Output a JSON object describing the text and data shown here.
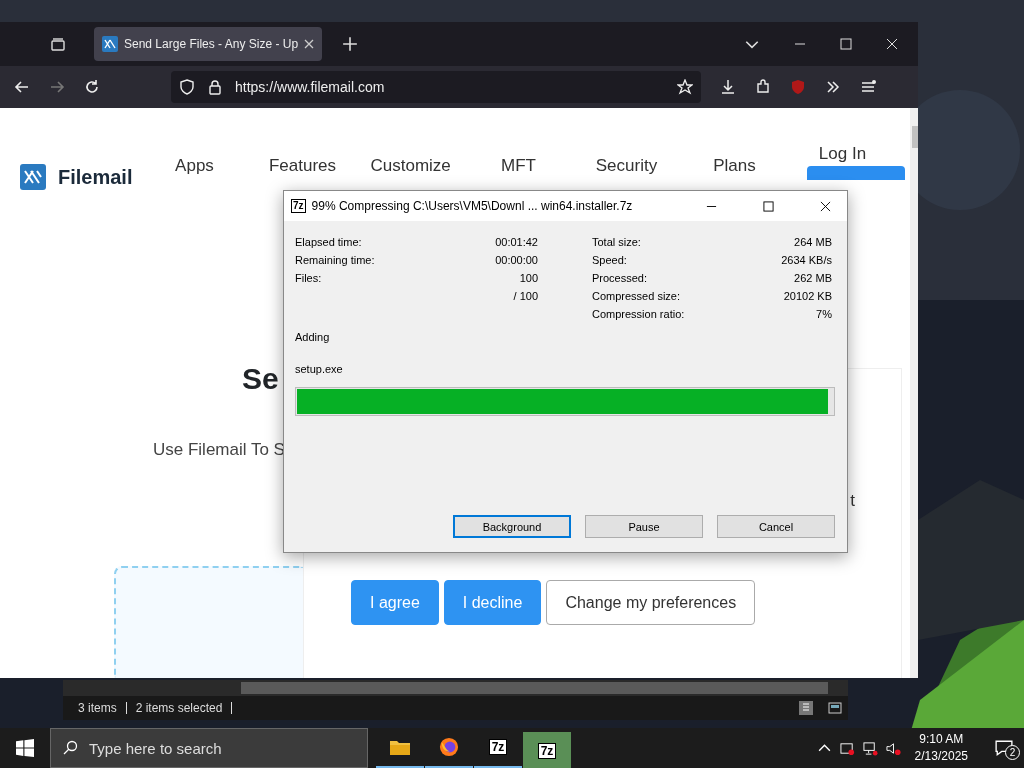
{
  "browser": {
    "tabs": [
      {
        "title": "Send Large Files - Any Size - Up",
        "selected": true
      }
    ],
    "url": "https://www.filemail.com",
    "page": {
      "logo": "Filemail",
      "nav": [
        "Apps",
        "Features",
        "Customize",
        "MFT",
        "Security",
        "Plans"
      ],
      "login": "Log In",
      "heading": "Se",
      "subtitle": "Use Filemail To S",
      "side_text": "t",
      "consent_buttons": [
        {
          "label": "I agree",
          "kind": "primary"
        },
        {
          "label": "I decline",
          "kind": "primary"
        },
        {
          "label": "Change my preferences",
          "kind": "outline"
        }
      ]
    }
  },
  "explorer_status": [
    "3 items",
    "2 items selected"
  ],
  "dialog": {
    "icon_text": "7z",
    "title": "99% Compressing C:\\Users\\VM5\\Downl ... win64.installer.7z",
    "left_stats": [
      {
        "label": "Elapsed time:",
        "value": "00:01:42"
      },
      {
        "label": "Remaining time:",
        "value": "00:00:00"
      },
      {
        "label": "Files:",
        "value": "100"
      },
      {
        "value": "/ 100"
      }
    ],
    "right_stats": [
      {
        "label": "Total size:",
        "value": "264 MB"
      },
      {
        "label": "Speed:",
        "value": "2634 KB/s"
      },
      {
        "label": "Processed:",
        "value": "262 MB"
      },
      {
        "label": "Compressed size:",
        "value": "20102 KB"
      },
      {
        "label": "Compression ratio:",
        "value": "7%"
      }
    ],
    "action": "Adding",
    "file": "setup.exe",
    "progress": {
      "level": 0.99
    },
    "buttons": [
      {
        "label": "Background",
        "focused": true
      },
      {
        "label": "Pause",
        "focused": false
      },
      {
        "label": "Cancel",
        "focused": false
      }
    ]
  },
  "taskbar": {
    "search_placeholder": "Type here to search",
    "apps": [
      {
        "kind": "folder",
        "active": false
      },
      {
        "kind": "browser",
        "active": false
      },
      {
        "kind": "archiver",
        "text": "7z",
        "active": false
      },
      {
        "kind": "archiver",
        "text": "7z",
        "active": true
      }
    ],
    "time": "9:10 AM",
    "date": "2/13/2025",
    "notifications": "2"
  }
}
